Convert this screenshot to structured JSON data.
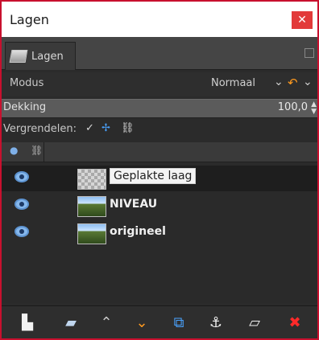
{
  "window": {
    "title": "Lagen",
    "close_icon": "✕"
  },
  "dock": {
    "tab_label": "Lagen"
  },
  "mode": {
    "label": "Modus",
    "value": "Normaal",
    "chevron": "⌄",
    "undo_icon": "↶",
    "chevron2": "⌄"
  },
  "opacity": {
    "label": "Dekking",
    "value": "100,0",
    "spin_up": "▲",
    "spin_down": "▼"
  },
  "lock": {
    "label": "Vergrendelen:",
    "icons": {
      "pixels": "✓",
      "position": "✢",
      "alpha": "⛓"
    }
  },
  "header": {
    "visibility_icon": "●",
    "chain_icon": "⛓"
  },
  "layers": [
    {
      "name": "Geplakte laag",
      "thumb": "checker",
      "selected": true
    },
    {
      "name": "NIVEAU",
      "thumb": "photo",
      "selected": false
    },
    {
      "name": "origineel",
      "thumb": "photo",
      "selected": false
    }
  ],
  "toolbar": {
    "new_layer_icon": "▙",
    "new_group_icon": "▰",
    "raise_icon": "⌃",
    "lower_icon": "⌄",
    "duplicate_icon": "⧉",
    "anchor_icon": "⚓",
    "mask_icon": "▱",
    "delete_icon": "✖"
  }
}
